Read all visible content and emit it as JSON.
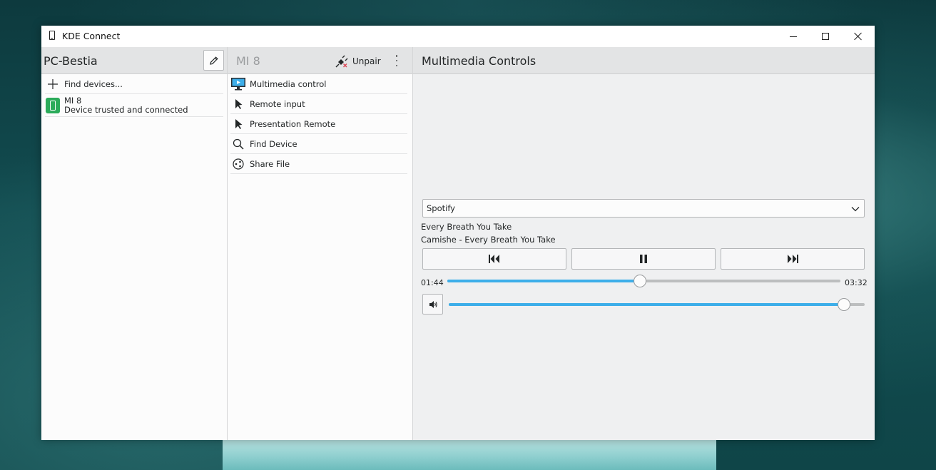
{
  "window": {
    "title": "KDE Connect",
    "controls": [
      "minimize-icon",
      "maximize-icon",
      "close-icon"
    ]
  },
  "left_panel": {
    "host_name": "PC-Bestia",
    "edit_icon": "pencil-icon",
    "find_devices_label": "Find devices...",
    "devices": [
      {
        "name": "MI 8",
        "status": "Device trusted and connected",
        "icon": "phone-icon",
        "status_color": "#2bab5a"
      }
    ]
  },
  "mid_panel": {
    "device_name": "MI 8",
    "unpair_label": "Unpair",
    "plugins": [
      {
        "label": "Multimedia control",
        "icon": "monitor-icon"
      },
      {
        "label": "Remote input",
        "icon": "pointer-icon"
      },
      {
        "label": "Presentation Remote",
        "icon": "pointer-icon"
      },
      {
        "label": "Find Device",
        "icon": "search-icon"
      },
      {
        "label": "Share File",
        "icon": "share-icon"
      }
    ]
  },
  "right_panel": {
    "title": "Multimedia Controls",
    "player": {
      "selected": "Spotify"
    },
    "track": {
      "title": "Every Breath You Take",
      "artist_line": "Camishe - Every Breath You Take"
    },
    "time_current": "01:44",
    "time_total": "03:32",
    "position_fraction": 0.49,
    "volume_fraction": 0.95,
    "accent_color": "#3daee9"
  }
}
